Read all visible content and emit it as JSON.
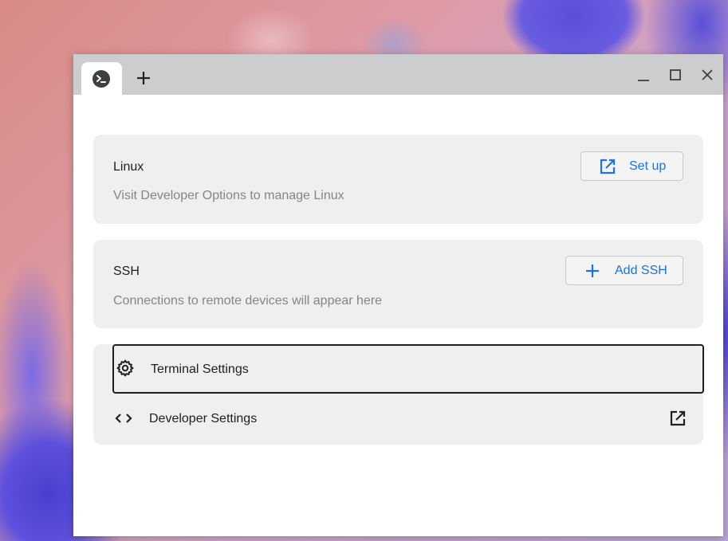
{
  "window": {
    "tab_icon": "terminal-prompt-icon",
    "new_tab_icon": "plus-icon",
    "controls": [
      "minimize-icon",
      "maximize-icon",
      "close-icon"
    ]
  },
  "linux": {
    "title": "Linux",
    "description": "Visit Developer Options to manage Linux",
    "button_label": "Set up",
    "button_icon": "open-in-new-icon"
  },
  "ssh": {
    "title": "SSH",
    "description": "Connections to remote devices will appear here",
    "button_label": "Add SSH",
    "button_icon": "plus-icon"
  },
  "settings": {
    "terminal_label": "Terminal Settings",
    "terminal_icon": "gear-icon",
    "developer_label": "Developer Settings",
    "developer_icon": "code-icon",
    "developer_trailing_icon": "open-in-new-icon"
  },
  "colors": {
    "accent": "#1a73e8",
    "titlebar": "#cccdce",
    "card": "#efefef",
    "muted_text": "#80868b"
  }
}
